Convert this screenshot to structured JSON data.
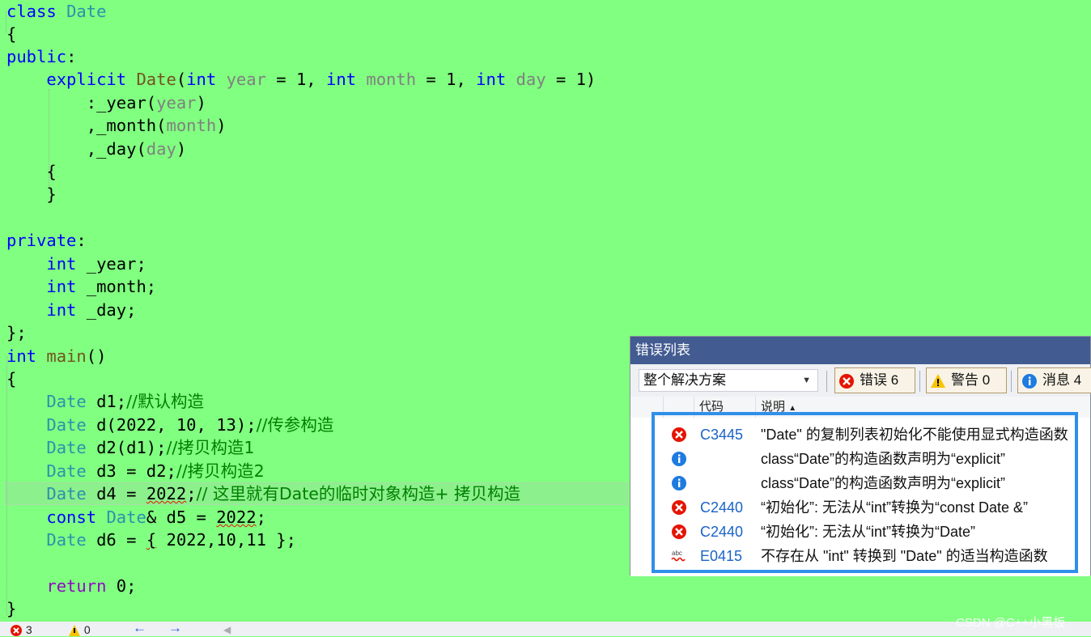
{
  "editor": {
    "lines": [
      "class Date",
      "{",
      "public:",
      "explicit Date(int year = 1, int month = 1, int day = 1)",
      ":_year(year)",
      ",_month(month)",
      ",_day(day)",
      "{",
      "}",
      "",
      "private:",
      "int _year;",
      "int _month;",
      "int _day;",
      "};",
      "int main()",
      "{",
      "Date d1;//默认构造",
      "Date d(2022, 10, 13);//传参构造",
      "Date d2(d1);//拷贝构造1",
      "Date d3 = d2;//拷贝构造2",
      "Date d4 = 2022;// 这里就有Date的临时对象构造+ 拷贝构造",
      "const Date& d5 = 2022;",
      "Date d6 = { 2022,10,11 };",
      "",
      "return 0;",
      "}"
    ]
  },
  "error_list": {
    "title": "错误列表",
    "scope": "整个解决方案",
    "errors_label": "错误 6",
    "warnings_label": "警告 0",
    "messages_label": "消息 4",
    "columns": {
      "code": "代码",
      "description": "说明"
    },
    "rows": [
      {
        "kind": "error",
        "code": "C3445",
        "description": "\"Date\" 的复制列表初始化不能使用显式构造函数"
      },
      {
        "kind": "info",
        "code": "",
        "description": "class“Date”的构造函数声明为“explicit”"
      },
      {
        "kind": "info",
        "code": "",
        "description": "class“Date”的构造函数声明为“explicit”"
      },
      {
        "kind": "error",
        "code": "C2440",
        "description": "“初始化”: 无法从“int”转换为“const Date &”"
      },
      {
        "kind": "error",
        "code": "C2440",
        "description": "“初始化”: 无法从“int”转换为“Date”"
      },
      {
        "kind": "intellisense",
        "code": "E0415",
        "description": "不存在从 \"int\" 转换到 \"Date\" 的适当构造函数"
      }
    ]
  },
  "status": {
    "errors": "3",
    "warnings": "0"
  },
  "watermark": "CSDN @C++小黑板",
  "colors": {
    "background": "#80ff80",
    "keyword": "#0000ff",
    "type": "#2b91af",
    "comment": "#008000",
    "panel_title": "#425b91",
    "highlight_box": "#2f8fea"
  }
}
